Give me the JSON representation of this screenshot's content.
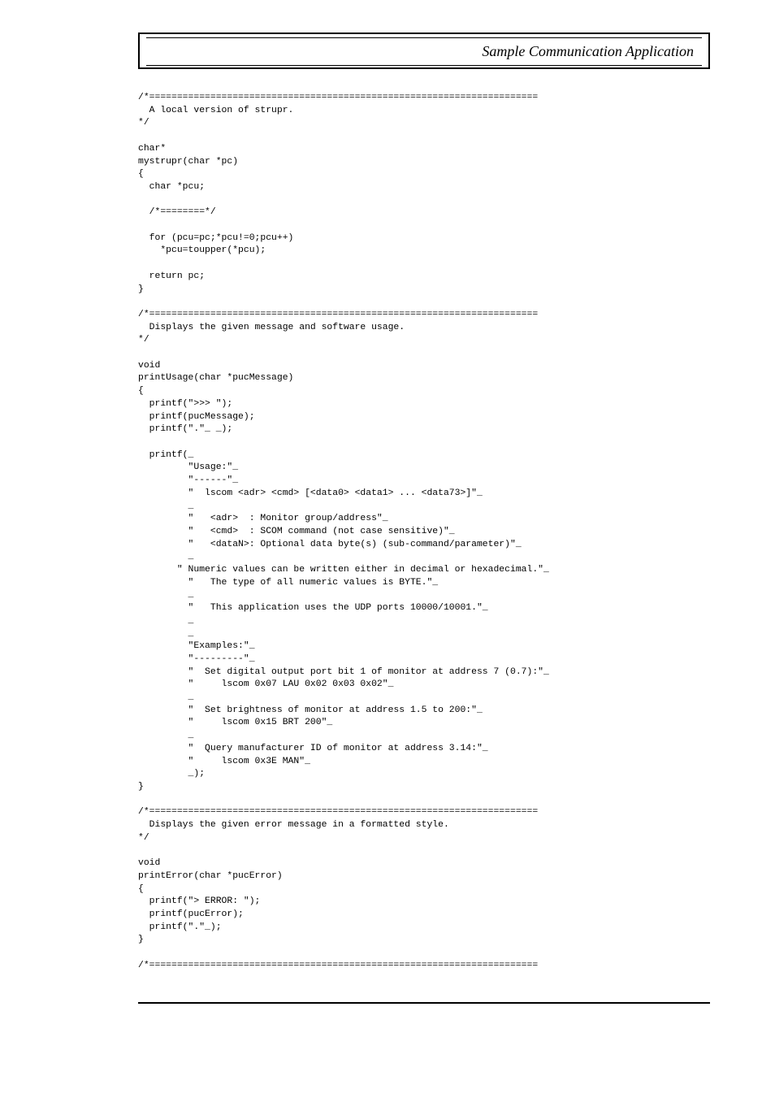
{
  "header": {
    "title": "Sample Communication Application"
  },
  "code": {
    "text": "/*======================================================================\n  A local version of strupr.\n*/\n\nchar*\nmystrupr(char *pc)\n{\n  char *pcu;\n\n  /*========*/\n\n  for (pcu=pc;*pcu!=0;pcu++)\n    *pcu=toupper(*pcu);\n\n  return pc;\n}\n\n/*======================================================================\n  Displays the given message and software usage.\n*/\n\nvoid\nprintUsage(char *pucMessage)\n{\n  printf(\">>> \");\n  printf(pucMessage);\n  printf(\".\"_ _);\n\n  printf(_\n         \"Usage:\"_\n         \"------\"_\n         \"  lscom <adr> <cmd> [<data0> <data1> ... <data73>]\"_\n         _\n         \"   <adr>  : Monitor group/address\"_\n         \"   <cmd>  : SCOM command (not case sensitive)\"_\n         \"   <dataN>: Optional data byte(s) (sub-command/parameter)\"_\n         _\n       \" Numeric values can be written either in decimal or hexadecimal.\"_\n         \"   The type of all numeric values is BYTE.\"_\n         _\n         \"   This application uses the UDP ports 10000/10001.\"_\n         _\n         _\n         \"Examples:\"_\n         \"---------\"_\n         \"  Set digital output port bit 1 of monitor at address 7 (0.7):\"_\n         \"     lscom 0x07 LAU 0x02 0x03 0x02\"_\n         _\n         \"  Set brightness of monitor at address 1.5 to 200:\"_\n         \"     lscom 0x15 BRT 200\"_\n         _\n         \"  Query manufacturer ID of monitor at address 3.14:\"_\n         \"     lscom 0x3E MAN\"_\n         _);\n}\n\n/*======================================================================\n  Displays the given error message in a formatted style.\n*/\n\nvoid\nprintError(char *pucError)\n{\n  printf(\"> ERROR: \");\n  printf(pucError);\n  printf(\".\"_);\n}\n\n/*======================================================================"
  }
}
